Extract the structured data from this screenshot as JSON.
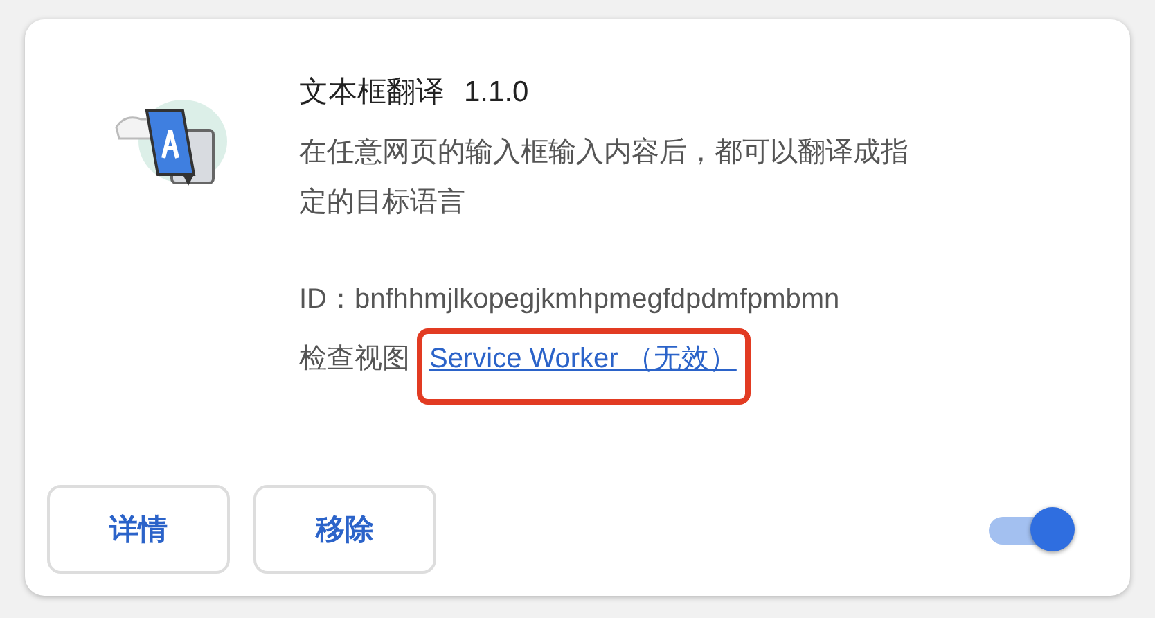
{
  "extension": {
    "name": "文本框翻译",
    "version": "1.1.0",
    "description": "在任意网页的输入框输入内容后，都可以翻译成指定的目标语言",
    "id_label": "ID：",
    "id": "bnfhhmjlkopegjkmhpmegfdpdmfpmbmn",
    "inspect_label": "检查视图",
    "inspect_link": "Service Worker （无效）",
    "link_highlighted": true
  },
  "buttons": [
    "详情",
    "移除"
  ],
  "toggle": {
    "on": true
  }
}
